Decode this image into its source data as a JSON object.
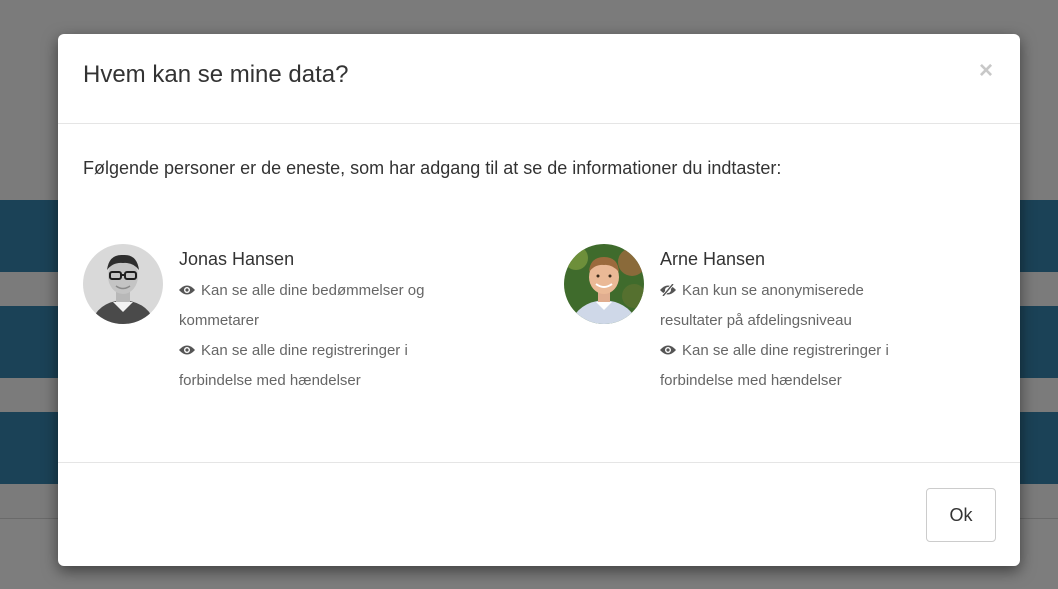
{
  "modal": {
    "title": "Hvem kan se mine data?",
    "close_symbol": "×",
    "intro": "Følgende personer er de eneste, som har adgang til at se de informationer du indtaster:",
    "ok_label": "Ok"
  },
  "people": [
    {
      "name": "Jonas Hansen",
      "permissions": [
        {
          "icon": "eye-icon",
          "text": "Kan se alle dine bedømmelser og",
          "text2": "kommetarer"
        },
        {
          "icon": "eye-icon",
          "text": "Kan se alle dine registreringer i",
          "text2": "forbindelse med hændelser"
        }
      ]
    },
    {
      "name": "Arne Hansen",
      "permissions": [
        {
          "icon": "eye-slash-icon",
          "text": "Kan kun se anonymiserede",
          "text2": "resultater på afdelingsniveau"
        },
        {
          "icon": "eye-icon",
          "text": "Kan se alle dine registreringer i",
          "text2": "forbindelse med hændelser"
        }
      ]
    }
  ],
  "colors": {
    "backdrop": "#7b7b7b",
    "background_band": "#1b4257",
    "text_primary": "#333333",
    "text_secondary": "#666666"
  }
}
